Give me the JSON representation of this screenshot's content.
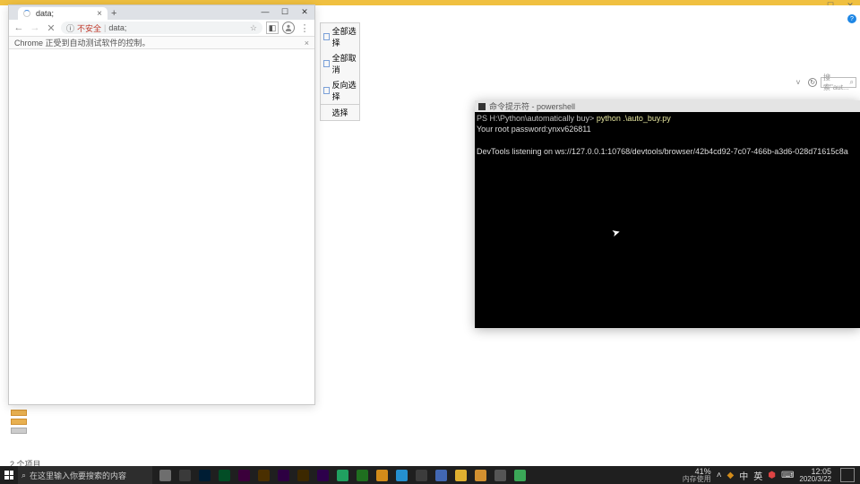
{
  "host_window": {
    "buttons": {
      "min": "—",
      "max": "☐",
      "close": "✕"
    }
  },
  "chrome": {
    "tab": {
      "title": "data;",
      "close": "×"
    },
    "newtab_label": "+",
    "win": {
      "min": "—",
      "max": "☐",
      "close": "✕"
    },
    "nav": {
      "back": "←",
      "forward": "→",
      "stop": "✕"
    },
    "url": {
      "security_icon": "ⓘ",
      "security_text": "不安全",
      "sep": "|",
      "value": "data;",
      "star": "☆"
    },
    "addr_icons": {
      "ext": "◧",
      "account": "◌",
      "kebab": "⋮"
    },
    "infobar": {
      "text": "Chrome 正受到自动测试软件的控制。",
      "close": "×"
    }
  },
  "context_menu": {
    "items": [
      "全部选择",
      "全部取消",
      "反向选择"
    ],
    "footer": "选择"
  },
  "toolbar_right": {
    "refresh": "↻",
    "help": "?",
    "search_placeholder": "搜索\"aut..."
  },
  "terminal": {
    "title": "命令提示符 - powershell",
    "line1_prompt": "PS H:\\Python\\automatically buy>",
    "line1_cmd": " python .\\auto_buy.py",
    "line2": "Your root password:ynxv626811",
    "line3": "",
    "line4": "DevTools listening on ws://127.0.0.1:10768/devtools/browser/42b4cd92-7c07-466b-a3d6-028d71615c8a"
  },
  "left_status": {
    "text": "2 个项目"
  },
  "taskbar": {
    "search_placeholder": "在这里输入你要搜索的内容",
    "icon_colors": [
      "#6e6e6e",
      "#3a3a3a",
      "#001d34",
      "#024d26",
      "#3b003b",
      "#4a2f00",
      "#2d0042",
      "#3c2800",
      "#2d004b",
      "#20a060",
      "#1f6f1f",
      "#d28b1a",
      "#2590d0",
      "#3c3c3c",
      "#4267b2",
      "#e0b030",
      "#d29030",
      "#555",
      "#3ba757"
    ],
    "tray": {
      "pct_value": "41%",
      "pct_label": "内存使用",
      "up": "˄",
      "lang1": "中",
      "lang2": "英",
      "ime": "⌨",
      "time": "12:05",
      "date": "2020/3/22"
    }
  }
}
